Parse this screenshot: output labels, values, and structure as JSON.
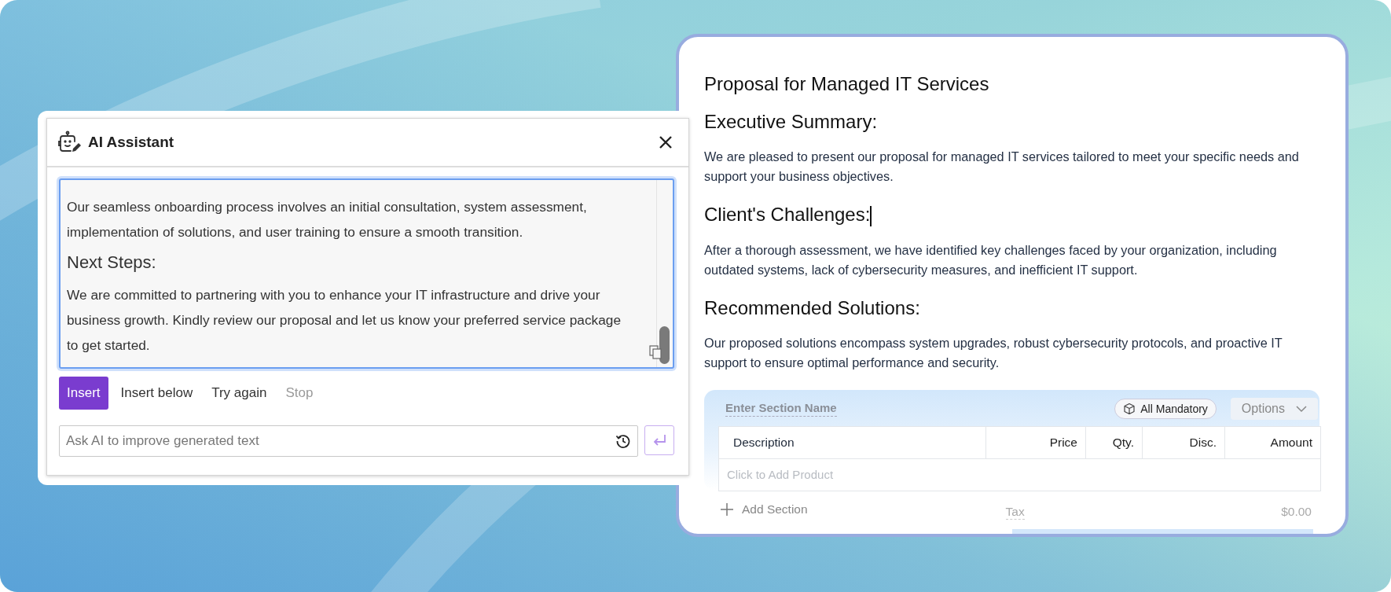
{
  "assistant": {
    "title": "AI Assistant",
    "content": [
      {
        "kind": "paragraph",
        "text": "Our seamless onboarding process involves an initial consultation, system assessment, implementation of solutions, and user training to ensure a smooth transition."
      },
      {
        "kind": "heading",
        "text": "Next Steps:"
      },
      {
        "kind": "paragraph",
        "text": "We are committed to partnering with you to enhance your IT infrastructure and drive your business growth. Kindly review our proposal and let us know your preferred service package to get started."
      }
    ],
    "actions": [
      {
        "label": "Insert",
        "kind": "primary",
        "disabled": false
      },
      {
        "label": "Insert below",
        "kind": "plain",
        "disabled": false
      },
      {
        "label": "Try again",
        "kind": "plain",
        "disabled": false
      },
      {
        "label": "Stop",
        "kind": "plain",
        "disabled": true
      }
    ],
    "prompt": {
      "placeholder": "Ask AI to improve generated text"
    }
  },
  "document": {
    "title": "Proposal for Managed IT Services",
    "sections": [
      {
        "heading": "Executive Summary:",
        "body": "We are pleased to present our proposal for managed IT services tailored to meet your specific needs and support your business objectives."
      },
      {
        "heading": "Client's Challenges:",
        "body": "After a thorough assessment, we have identified key challenges faced by your organization, including outdated systems, lack of cybersecurity measures, and inefficient IT support."
      },
      {
        "heading": "Recommended Solutions:",
        "body": "Our proposed solutions encompass system upgrades, robust cybersecurity protocols, and proactive IT support to ensure optimal performance and security."
      }
    ],
    "pricing": {
      "section_name": {
        "placeholder": "Enter Section Name"
      },
      "badge": "All Mandatory",
      "options": "Options",
      "columns": [
        "Description",
        "Price",
        "Qty.",
        "Disc.",
        "Amount"
      ],
      "empty_row": "Click to Add Product",
      "add_section": "Add Section",
      "tax_label": "Tax",
      "tax_value": "$0.00"
    }
  }
}
